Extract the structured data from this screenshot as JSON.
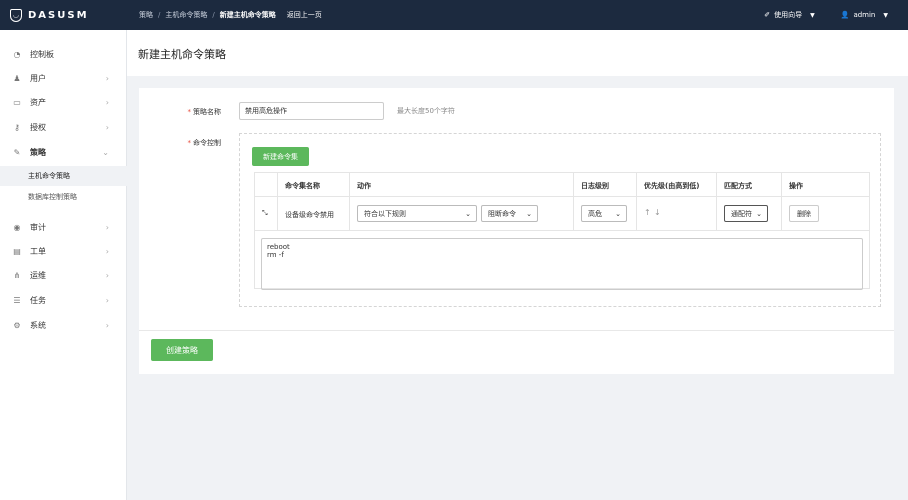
{
  "brand": {
    "name": "DASUSM"
  },
  "breadcrumb": {
    "items": [
      "策略",
      "主机命令策略",
      "新建主机命令策略"
    ],
    "separator": "/",
    "back": "返回上一页"
  },
  "topbar": {
    "guide": "使用向导",
    "user": "admin"
  },
  "sidebar": {
    "items": [
      {
        "label": "控制板",
        "icon": "dashboard-icon"
      },
      {
        "label": "用户",
        "icon": "user-icon"
      },
      {
        "label": "资产",
        "icon": "monitor-icon"
      },
      {
        "label": "授权",
        "icon": "key-icon"
      },
      {
        "label": "策略",
        "icon": "pin-icon"
      },
      {
        "label": "审计",
        "icon": "eye-icon"
      },
      {
        "label": "工单",
        "icon": "file-icon"
      },
      {
        "label": "运维",
        "icon": "sitemap-icon"
      },
      {
        "label": "任务",
        "icon": "list-icon"
      },
      {
        "label": "系统",
        "icon": "gear-icon"
      }
    ],
    "sub_items": [
      "主机命令策略",
      "数据库控制策略"
    ]
  },
  "page": {
    "title": "新建主机命令策略"
  },
  "form": {
    "name_label": "策略名称",
    "name_value": "禁用高危操作",
    "name_hint": "最大长度50个字符",
    "cmd_label": "命令控制",
    "new_set_button": "新建命令集",
    "table": {
      "headers": [
        "命令集名称",
        "动作",
        "日志级别",
        "优先级(由高到低)",
        "匹配方式",
        "操作"
      ],
      "row": {
        "name": "设备级命令禁用",
        "action_condition": "符合以下规则",
        "action_result": "阻断命令",
        "log_level": "高危",
        "match": "通配符",
        "delete": "删除"
      }
    },
    "commands": [
      "reboot",
      "rm -f"
    ],
    "submit_button": "创建策略"
  },
  "colors": {
    "topbar": "#1c2a3f",
    "accent_green": "#5cb85c",
    "required": "#e74c3c"
  }
}
